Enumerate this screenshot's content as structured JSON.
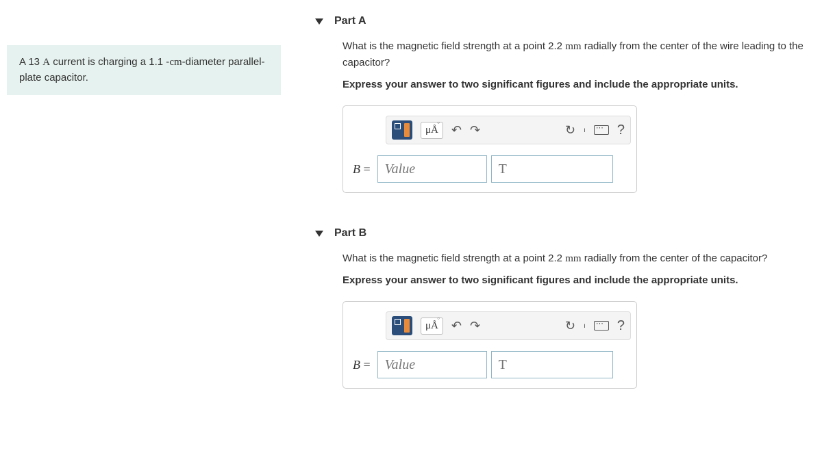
{
  "problem": {
    "text_parts": [
      "A 13 ",
      "A",
      " current is charging a 1.1 -",
      "cm",
      "-diameter parallel-plate capacitor."
    ]
  },
  "parts": [
    {
      "label": "Part A",
      "question_parts": [
        "What is the magnetic field strength at a point 2.2 ",
        "mm",
        " radially from the center of the wire leading to the capacitor?"
      ],
      "instruction": "Express your answer to two significant figures and include the appropriate units.",
      "var": "B",
      "eq": " = ",
      "value_placeholder": "Value",
      "unit_placeholder": "T",
      "units_btn": "μÅ",
      "help": "?"
    },
    {
      "label": "Part B",
      "question_parts": [
        "What is the magnetic field strength at a point 2.2 ",
        "mm",
        " radially from the center of the capacitor?"
      ],
      "instruction": "Express your answer to two significant figures and include the appropriate units.",
      "var": "B",
      "eq": " = ",
      "value_placeholder": "Value",
      "unit_placeholder": "T",
      "units_btn": "μÅ",
      "help": "?"
    }
  ]
}
